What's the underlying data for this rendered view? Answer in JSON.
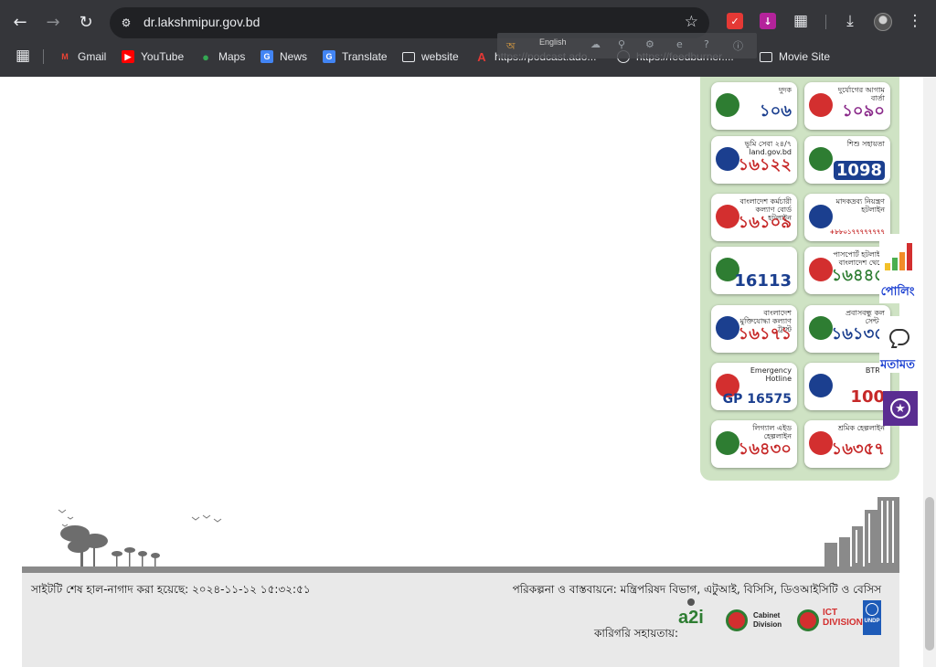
{
  "browser": {
    "url": "dr.lakshmipur.gov.bd",
    "bookmarks": [
      {
        "label": "Gmail",
        "icon": "gmail-icon"
      },
      {
        "label": "YouTube",
        "icon": "youtube-icon"
      },
      {
        "label": "Maps",
        "icon": "maps-icon"
      },
      {
        "label": "News",
        "icon": "news-icon"
      },
      {
        "label": "Translate",
        "icon": "translate-icon"
      },
      {
        "label": "website",
        "icon": "folder-icon"
      },
      {
        "label": "https://podcast.ado...",
        "icon": "adobe-icon"
      },
      {
        "label": "https://feedburner....",
        "icon": "globe-icon"
      },
      {
        "label": "Movie Site",
        "icon": "folder-icon"
      }
    ],
    "translate_popup": {
      "language": "English"
    }
  },
  "hotlines": [
    {
      "number": "১০৬",
      "caption": "দুদক",
      "color": "#1b3f8f"
    },
    {
      "number": "১০৯০",
      "caption": "দুর্যোগের আগাম বার্তা",
      "color": "#8a2a8a"
    },
    {
      "number": "১৬১২২",
      "caption": "ভূমি সেবা ২৪/৭ land.gov.bd",
      "color": "#c62828"
    },
    {
      "number": "1098",
      "caption": "শিশু সহায়তা",
      "color": "#ffffff"
    },
    {
      "number": "১৬১০৯",
      "caption": "বাংলাদেশ কর্মচারী কল্যাণ বোর্ড হটলাইন",
      "color": "#c62828"
    },
    {
      "number": "+৮৮০১৭৭৭৭৭৭৭৭",
      "caption": "মাদকদ্রব্য নিয়ন্ত্রণ হটলাইন",
      "color": "#c62828"
    },
    {
      "number": "16113",
      "caption": "",
      "color": "#1b3f8f"
    },
    {
      "number": "১৬৪৪৫",
      "caption": "পাসপোর্ট হটলাইন বাংলাদেশ থেকে",
      "color": "#2e7d32"
    },
    {
      "number": "১৬১৭১",
      "caption": "বাংলাদেশ মুক্তিযোদ্ধা কল্যাণ ট্রাস্ট",
      "color": "#c62828"
    },
    {
      "number": "১৬১৩৫",
      "caption": "প্রবাসবন্ধু কল সেন্টার",
      "color": "#1b3f8f"
    },
    {
      "number": "GP 16575",
      "caption": "Emergency Hotline",
      "color": "#1b3f8f"
    },
    {
      "number": "100",
      "caption": "BTRC",
      "color": "#c62828"
    },
    {
      "number": "১৬৪৩০",
      "caption": "লিগ্যাল এইড হেল্পলাইন",
      "color": "#c62828"
    },
    {
      "number": "১৬৩৫৭",
      "caption": "শ্রমিক হেল্পলাইন",
      "color": "#c62828"
    }
  ],
  "side_widgets": {
    "poll_label": "পোলিং",
    "opinion_label": "মতামত"
  },
  "footer": {
    "last_updated": "সাইটটি শেষ হাল-নাগাদ করা হয়েছে: ২০২৪-১১-১২ ১৫:৩২:৫১",
    "credits": "পরিকল্পনা ও বাস্তবায়নে: মন্ত্রিপরিষদ বিভাগ,  এটুআই,  বিসিসি,  ডিওআইসিটি ও  বেসিস",
    "tech_support": "কারিগরি সহায়তায়:",
    "logos": {
      "a2i": "a2i",
      "cabinet": "Cabinet Division",
      "ict": "ICT DIVISION",
      "undp": "UNDP"
    }
  }
}
